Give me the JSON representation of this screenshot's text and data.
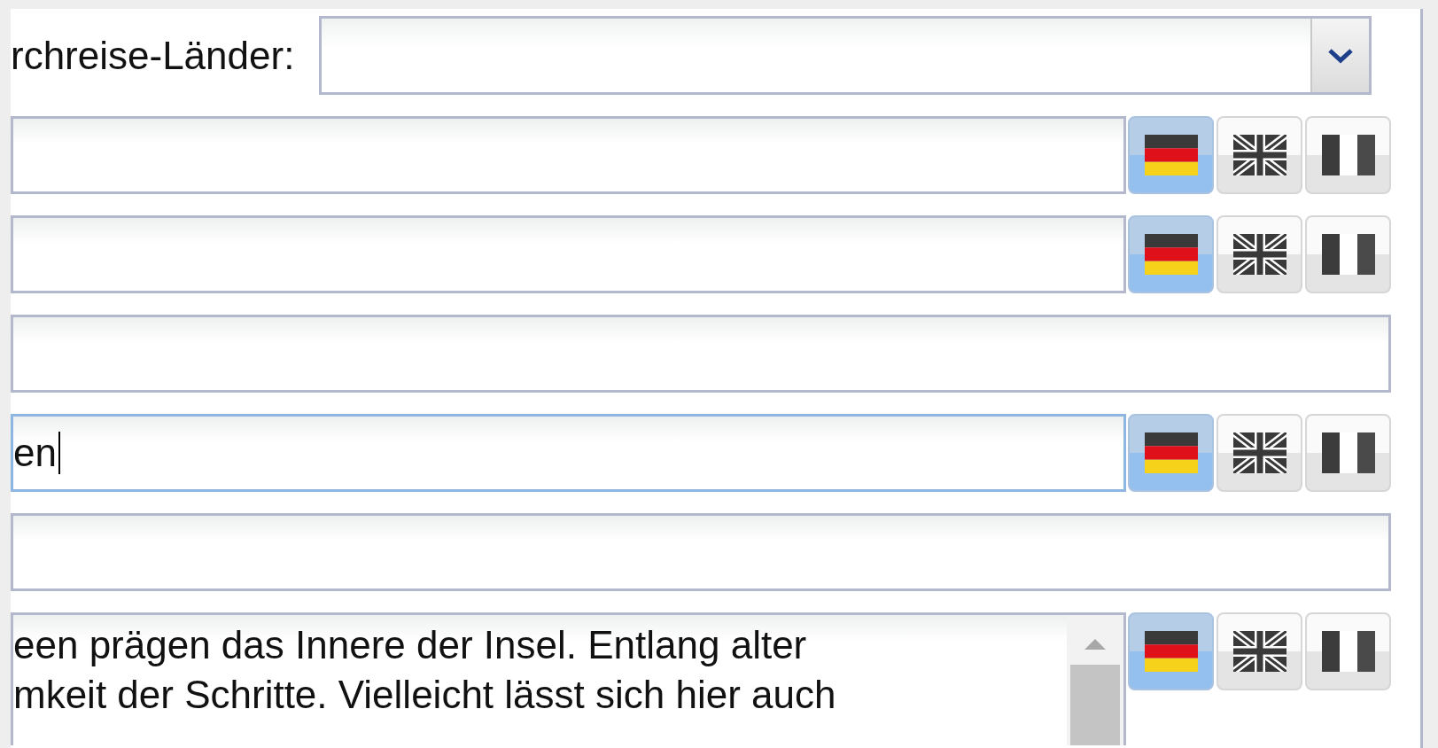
{
  "transit_countries": {
    "label": "rchreise-Länder:"
  },
  "rows": [
    {
      "kind": "text",
      "focused": false,
      "languages": [
        {
          "kind": "de",
          "selected": true
        },
        {
          "kind": "gb",
          "selected": false
        },
        {
          "kind": "fr",
          "selected": false
        }
      ]
    },
    {
      "kind": "text",
      "focused": false,
      "languages": [
        {
          "kind": "de",
          "selected": true
        },
        {
          "kind": "gb",
          "selected": false
        },
        {
          "kind": "fr",
          "selected": false
        }
      ]
    },
    {
      "kind": "plain",
      "focused": false
    },
    {
      "kind": "text",
      "focused": true,
      "value": "en",
      "languages": [
        {
          "kind": "de",
          "selected": true
        },
        {
          "kind": "gb",
          "selected": false
        },
        {
          "kind": "fr",
          "selected": false
        }
      ]
    },
    {
      "kind": "plain",
      "focused": false
    },
    {
      "kind": "textarea",
      "focused": false,
      "lines": [
        "een prägen das Innere der Insel. Entlang alter",
        "mkeit der Schritte. Vielleicht lässt sich hier auch"
      ],
      "languages": [
        {
          "kind": "de",
          "selected": true
        },
        {
          "kind": "gb",
          "selected": false
        },
        {
          "kind": "fr",
          "selected": false
        }
      ]
    }
  ]
}
